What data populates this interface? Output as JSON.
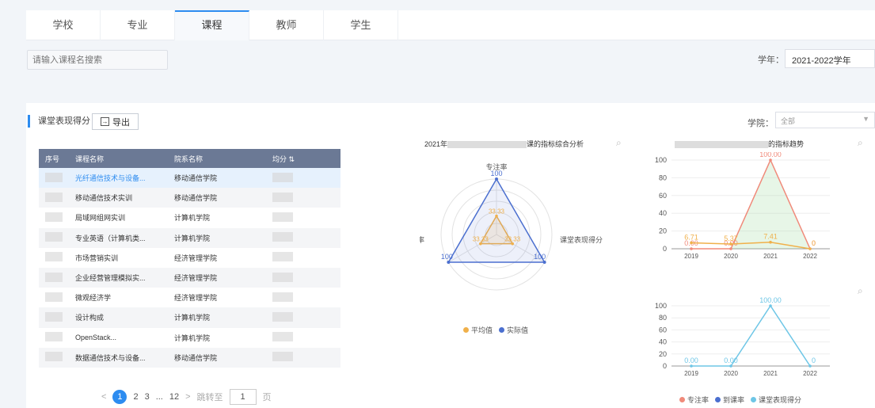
{
  "tabs": [
    "学校",
    "专业",
    "课程",
    "教师",
    "学生"
  ],
  "search": {
    "placeholder": "请输入课程名搜索"
  },
  "year": {
    "label": "学年：",
    "value": "2021-2022学年"
  },
  "panel": {
    "title": "课堂表现得分",
    "export_label": "导出"
  },
  "college": {
    "label": "学院：",
    "value": "全部"
  },
  "table": {
    "headers": [
      "序号",
      "课程名称",
      "院系名称",
      "均分"
    ],
    "rows": [
      {
        "name": "光纤通信技术与设备...",
        "dept": "移动通信学院"
      },
      {
        "name": "移动通信技术实训",
        "dept": "移动通信学院"
      },
      {
        "name": "局域网组网实训",
        "dept": "计算机学院"
      },
      {
        "name": "专业英语（计算机类...",
        "dept": "计算机学院"
      },
      {
        "name": "市场营销实训",
        "dept": "经济管理学院"
      },
      {
        "name": "企业经营管理模拟实...",
        "dept": "经济管理学院"
      },
      {
        "name": "微观经济学",
        "dept": "经济管理学院"
      },
      {
        "name": "设计构成",
        "dept": "计算机学院"
      },
      {
        "name": "OpenStack...",
        "dept": "计算机学院"
      },
      {
        "name": "数据通信技术与设备...",
        "dept": "移动通信学院"
      }
    ]
  },
  "pager": {
    "prev": "<",
    "pages": [
      "1",
      "2",
      "3",
      "...",
      "12"
    ],
    "next": ">",
    "jump_label": "跳转至",
    "jump_value": "1",
    "page_unit": "页"
  },
  "radar": {
    "title_start": "2021年",
    "title_end": "课的指标综合分析",
    "axes": [
      "专注率",
      "课堂表现得分",
      "到课率"
    ],
    "avg_labels": [
      "33.33",
      "33.33",
      "33.33"
    ],
    "actual_labels": [
      "100",
      "100",
      "100"
    ],
    "legend": [
      "平均值",
      "实际值"
    ]
  },
  "trend1": {
    "title_end": "的指标趋势",
    "x": [
      "2019",
      "2020",
      "2021",
      "2022"
    ],
    "y_ticks": [
      "0",
      "20",
      "40",
      "60",
      "80",
      "100"
    ],
    "red_labels": [
      "0.00",
      "0.00",
      "100.00",
      "0"
    ],
    "orange_labels": [
      "6.71",
      "5.37",
      "7.41",
      "0"
    ]
  },
  "trend2": {
    "x": [
      "2019",
      "2020",
      "2021",
      "2022"
    ],
    "y_ticks": [
      "0",
      "20",
      "40",
      "60",
      "80",
      "100"
    ],
    "labels": [
      "0.00",
      "0.00",
      "100.00",
      "0"
    ]
  },
  "bottom_legend": [
    "专注率",
    "到课率",
    "课堂表现得分"
  ],
  "chart_data": [
    {
      "type": "radar",
      "categories": [
        "专注率",
        "课堂表现得分",
        "到课率"
      ],
      "series": [
        {
          "name": "平均值",
          "values": [
            33.33,
            33.33,
            33.33
          ]
        },
        {
          "name": "实际值",
          "values": [
            100,
            100,
            100
          ]
        }
      ],
      "legend": "bottom",
      "colors": [
        "#f0b04a",
        "#4b6fcf"
      ]
    },
    {
      "type": "line",
      "x": [
        "2019",
        "2020",
        "2021",
        "2022"
      ],
      "series": [
        {
          "values": [
            0,
            0,
            100,
            0
          ]
        },
        {
          "values": [
            6.71,
            5.37,
            7.41,
            0
          ]
        }
      ],
      "ylim": [
        0,
        100
      ],
      "colors": [
        "#f08a7a",
        "#f0b04a"
      ]
    },
    {
      "type": "line",
      "x": [
        "2019",
        "2020",
        "2021",
        "2022"
      ],
      "series": [
        {
          "name": "课堂表现得分",
          "values": [
            0,
            0,
            100,
            0
          ]
        }
      ],
      "ylim": [
        0,
        100
      ],
      "legend": "bottom",
      "colors": [
        "#6ec6e6"
      ]
    }
  ]
}
